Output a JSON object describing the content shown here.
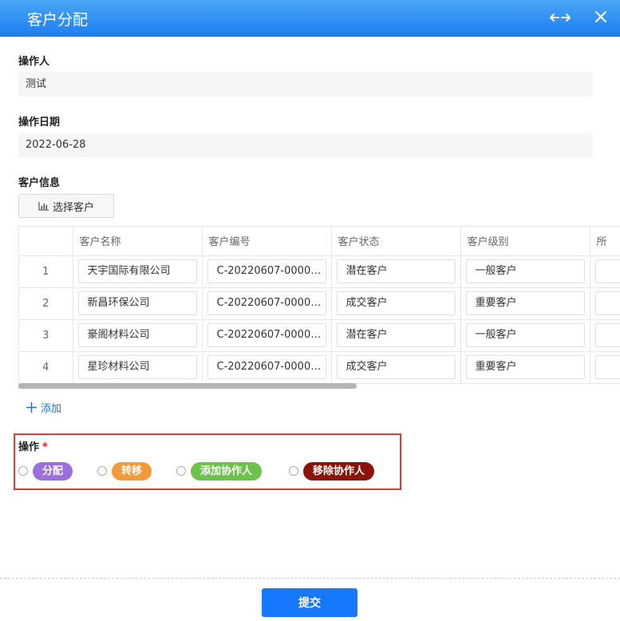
{
  "window": {
    "title": "客户分配",
    "expand_icon": "arrows-horizontal-icon",
    "close_icon": "close-icon"
  },
  "operator": {
    "label": "操作人",
    "value": "测试"
  },
  "operation_date": {
    "label": "操作日期",
    "value": "2022-06-28"
  },
  "customer_info": {
    "label": "客户信息",
    "select_button": {
      "icon": "bar-chart-icon",
      "label": "选择客户"
    },
    "columns": [
      "",
      "客户名称",
      "客户编号",
      "客户状态",
      "客户级别",
      "所"
    ],
    "rows": [
      {
        "index": "1",
        "name": "天宇国际有限公司",
        "code": "C-20220607-00000…",
        "status": "潜在客户",
        "level": "一般客户"
      },
      {
        "index": "2",
        "name": "新昌环保公司",
        "code": "C-20220607-00000…",
        "status": "成交客户",
        "level": "重要客户"
      },
      {
        "index": "3",
        "name": "豪阁材料公司",
        "code": "C-20220607-00000…",
        "status": "潜在客户",
        "level": "一般客户"
      },
      {
        "index": "4",
        "name": "星珍材料公司",
        "code": "C-20220607-00000…",
        "status": "成交客户",
        "level": "重要客户"
      }
    ],
    "add_link": {
      "icon": "plus-icon",
      "label": "添加"
    }
  },
  "operation": {
    "label": "操作",
    "required_mark": "*",
    "options": [
      {
        "label": "分配",
        "color": "#9b6fdc"
      },
      {
        "label": "转移",
        "color": "#f59a3b"
      },
      {
        "label": "添加协作人",
        "color": "#6cc24a"
      },
      {
        "label": "移除协作人",
        "color": "#8b1408"
      }
    ]
  },
  "submit_label": "提交",
  "colors": {
    "accent": "#1677ff",
    "highlight_border": "#e53935"
  }
}
